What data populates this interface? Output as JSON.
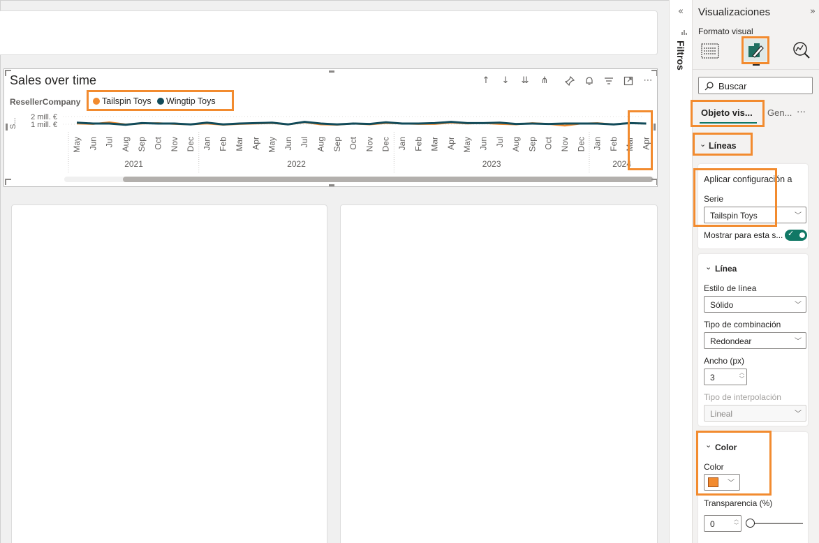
{
  "visual": {
    "title": "Sales over time",
    "legend_title": "ResellerCompany",
    "legend": [
      {
        "name": "Tailspin Toys",
        "color": "#f28b2f"
      },
      {
        "name": "Wingtip Toys",
        "color": "#124b5a"
      }
    ],
    "y_ticks": [
      "2 mill. €",
      "1 mill. €"
    ],
    "y_axis_label": "S..."
  },
  "chart_data": {
    "type": "line",
    "title": "Sales over time",
    "x": [
      "May",
      "Jun",
      "Jul",
      "Aug",
      "Sep",
      "Oct",
      "Nov",
      "Dec",
      "Jan",
      "Feb",
      "Mar",
      "Apr",
      "May",
      "Jun",
      "Jul",
      "Aug",
      "Sep",
      "Oct",
      "Nov",
      "Dec",
      "Jan",
      "Feb",
      "Mar",
      "Apr",
      "May",
      "Jun",
      "Jul",
      "Aug",
      "Sep",
      "Oct",
      "Nov",
      "Dec",
      "Jan",
      "Feb",
      "Mar",
      "Apr"
    ],
    "years": [
      {
        "label": "2021",
        "start": 0,
        "end": 7
      },
      {
        "label": "2022",
        "start": 8,
        "end": 19
      },
      {
        "label": "2023",
        "start": 20,
        "end": 31
      },
      {
        "label": "2024",
        "start": 32,
        "end": 35
      }
    ],
    "y_ticks": [
      "2 mill. €",
      "1 mill. €"
    ],
    "ylim": [
      0,
      2
    ],
    "series": [
      {
        "name": "Tailspin Toys",
        "color": "#f28b2f",
        "values": [
          1.3,
          1.25,
          1.45,
          1.2,
          1.3,
          1.35,
          1.25,
          1.2,
          1.3,
          1.15,
          1.25,
          1.3,
          1.35,
          1.2,
          1.45,
          1.2,
          1.15,
          1.3,
          1.2,
          1.35,
          1.3,
          1.25,
          1.25,
          1.4,
          1.3,
          1.35,
          1.25,
          1.2,
          1.35,
          1.25,
          1.05,
          1.3,
          1.35,
          1.2,
          1.35,
          1.3
        ]
      },
      {
        "name": "Wingtip Toys",
        "color": "#124b5a",
        "values": [
          1.4,
          1.3,
          1.3,
          1.15,
          1.35,
          1.3,
          1.3,
          1.2,
          1.4,
          1.2,
          1.3,
          1.35,
          1.4,
          1.2,
          1.5,
          1.3,
          1.2,
          1.3,
          1.25,
          1.45,
          1.3,
          1.3,
          1.35,
          1.5,
          1.35,
          1.35,
          1.4,
          1.25,
          1.3,
          1.25,
          1.3,
          1.3,
          1.3,
          1.2,
          1.35,
          1.3
        ]
      }
    ]
  },
  "filters": {
    "label": "Filtros"
  },
  "pane": {
    "title": "Visualizaciones",
    "subtitle": "Formato visual",
    "search_placeholder": "Buscar",
    "tabs": [
      "Objeto vis...",
      "Gen...",
      "···"
    ],
    "lineas_section": "Líneas",
    "apply_settings": "Aplicar configuración a",
    "serie_label": "Serie",
    "serie_value": "Tailspin Toys",
    "show_series": "Mostrar para esta s...",
    "linea_section": "Línea",
    "line_style_label": "Estilo de línea",
    "line_style_value": "Sólido",
    "join_type_label": "Tipo de combinación",
    "join_type_value": "Redondear",
    "width_label": "Ancho (px)",
    "width_value": "3",
    "interp_label": "Tipo de interpolación",
    "interp_value": "Lineal",
    "color_section": "Color",
    "color_label": "Color",
    "color_value": "#f28b2f",
    "transparency_label": "Transparencia (%)",
    "transparency_value": "0",
    "transparency_level": 0
  },
  "colors": {
    "highlight": "#f28b2f",
    "toggle": "#117865"
  }
}
